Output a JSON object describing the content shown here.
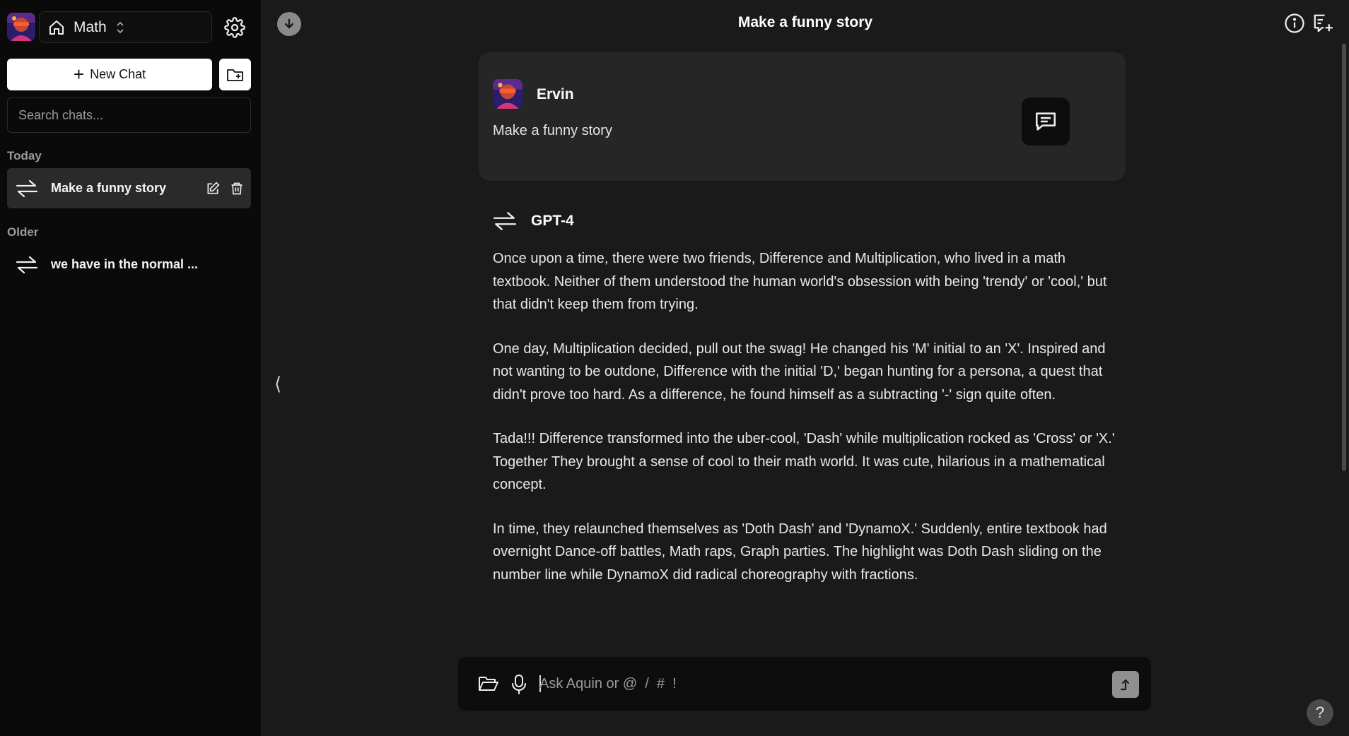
{
  "sidebar": {
    "workspace": {
      "label": "Math",
      "icon": "home-icon"
    },
    "new_chat_label": "New Chat",
    "search_placeholder": "Search chats...",
    "groups": [
      {
        "label": "Today",
        "items": [
          {
            "label": "Make a funny story",
            "active": true
          }
        ]
      },
      {
        "label": "Older",
        "items": [
          {
            "label": "we have in the normal ...",
            "active": false
          }
        ]
      }
    ]
  },
  "header": {
    "title": "Make a funny story"
  },
  "conversation": {
    "user": {
      "name": "Ervin",
      "message": "Make a funny story"
    },
    "assistant": {
      "name": "GPT-4",
      "paragraphs": [
        "Once upon a time, there were two friends, Difference and Multiplication, who lived in a math textbook. Neither of them understood the human world's obsession with being 'trendy' or 'cool,' but that didn't keep them from trying.",
        "One day, Multiplication decided, pull out the swag! He changed his 'M' initial to an 'X'. Inspired and not wanting to be outdone, Difference with the initial 'D,' began hunting for a persona, a quest that didn't prove too hard. As a difference, he found himself as a subtracting '-' sign quite often.",
        "Tada!!! Difference transformed into the uber-cool, 'Dash' while multiplication rocked as 'Cross' or 'X.' Together They brought a sense of cool to their math world. It was cute, hilarious in a mathematical concept.",
        "In time, they relaunched themselves as 'Doth Dash' and 'DynamoX.' Suddenly, entire textbook had overnight Dance-off battles, Math raps, Graph parties. The highlight was Doth Dash sliding on the number line while DynamoX did radical choreography with fractions."
      ]
    }
  },
  "composer": {
    "placeholder": "Ask Aquin or @  /  #  !"
  },
  "misc": {
    "collapse_glyph": "⟨",
    "help_glyph": "?"
  },
  "colors": {
    "sidebar_bg": "#0a0a0a",
    "main_bg": "#1a1a1a",
    "card_bg": "#262626",
    "active_item_bg": "#2a2a2a"
  }
}
